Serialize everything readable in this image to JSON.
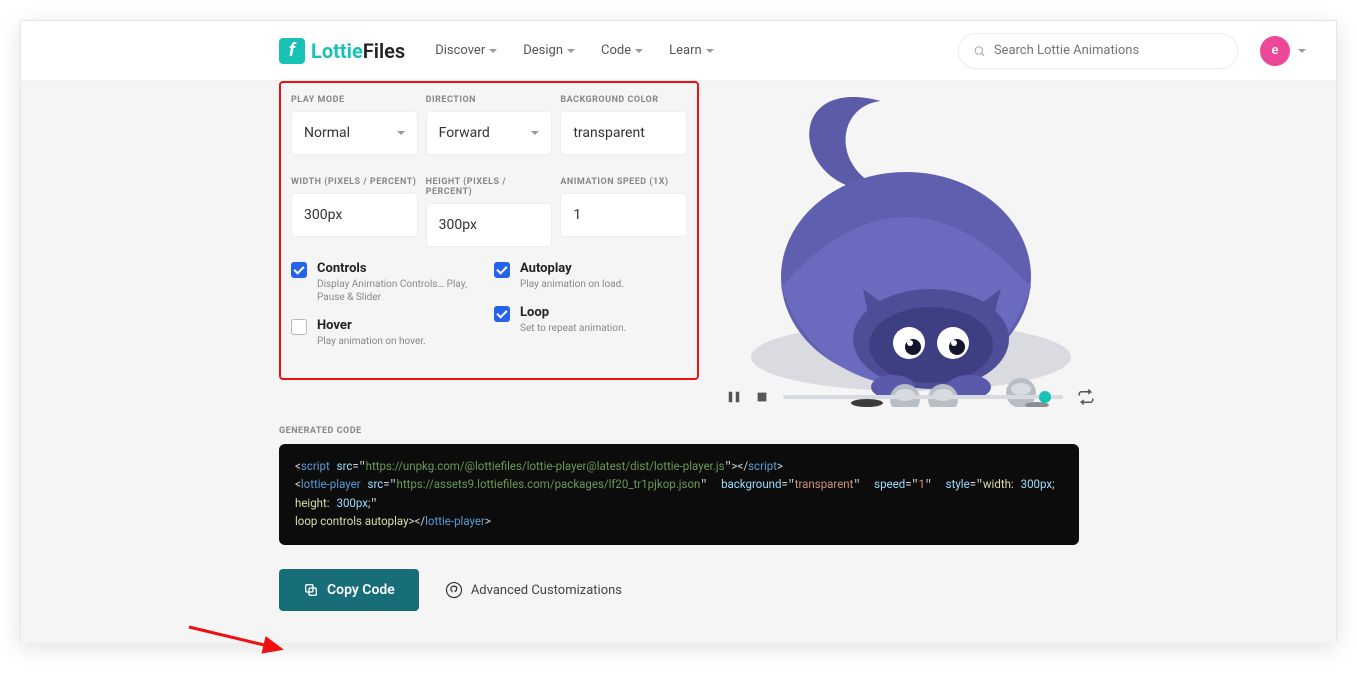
{
  "brand": {
    "logo": "LottieFiles"
  },
  "nav": {
    "items": [
      "Discover",
      "Design",
      "Code",
      "Learn"
    ],
    "search_placeholder": "Search Lottie Animations",
    "avatar_initial": "e"
  },
  "options": {
    "playmode": {
      "label": "PLAY MODE",
      "value": "Normal"
    },
    "direction": {
      "label": "DIRECTION",
      "value": "Forward"
    },
    "bgcolor": {
      "label": "BACKGROUND COLOR",
      "value": "transparent"
    },
    "width": {
      "label": "WIDTH (PIXELS / PERCENT)",
      "value": "300px"
    },
    "height": {
      "label": "HEIGHT (PIXELS / PERCENT)",
      "value": "300px"
    },
    "speed": {
      "label": "ANIMATION SPEED (1X)",
      "value": "1"
    },
    "controls": {
      "checked": true,
      "title": "Controls",
      "desc": "Display Animation Controls… Play, Pause & Slider"
    },
    "autoplay": {
      "checked": true,
      "title": "Autoplay",
      "desc": "Play animation on load."
    },
    "hover": {
      "checked": false,
      "title": "Hover",
      "desc": "Play animation on hover."
    },
    "loop": {
      "checked": true,
      "title": "Loop",
      "desc": "Set to repeat animation."
    }
  },
  "generated": {
    "label": "GENERATED CODE",
    "script_src": "https://unpkg.com/@lottiefiles/lottie-player@latest/dist/lottie-player.js",
    "player_src": "https://assets9.lottiefiles.com/packages/lf20_tr1pjkop.json",
    "background": "transparent",
    "speed": "1",
    "style": "width: 300px; height: 300px;",
    "flags": "loop controls autoplay"
  },
  "actions": {
    "copy": "Copy Code",
    "advanced": "Advanced Customizations"
  }
}
